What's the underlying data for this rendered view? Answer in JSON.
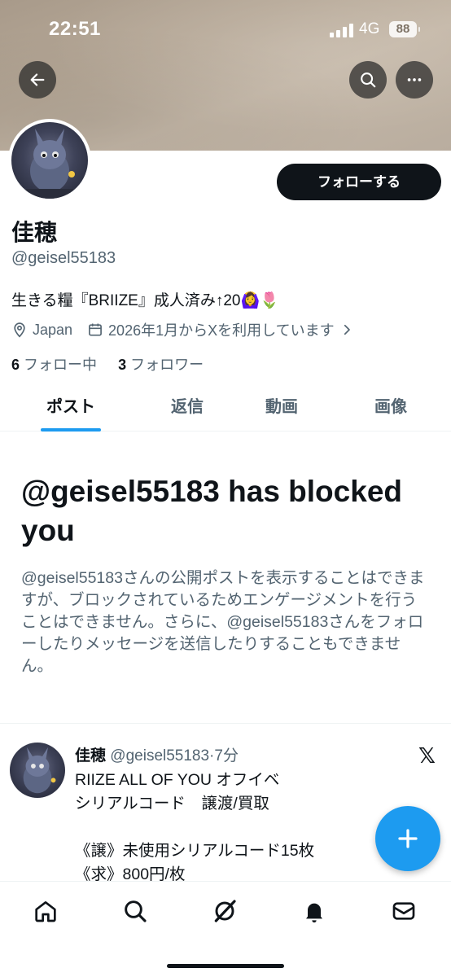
{
  "status_bar": {
    "time": "22:51",
    "network": "4G",
    "battery": "88"
  },
  "profile": {
    "name": "佳穂",
    "handle": "@geisel55183",
    "bio": "生きる糧『BRIIZE』成人済み↑20🙆‍♀️🌷",
    "location": "Japan",
    "joined": "2026年1月からXを利用しています",
    "following_count": "6",
    "following_label": "フォロー中",
    "followers_count": "3",
    "followers_label": "フォロワー",
    "follow_button": "フォローする"
  },
  "tabs": [
    "ポスト",
    "返信",
    "動画",
    "画像"
  ],
  "blocked": {
    "title": "@geisel55183 has blocked you",
    "description": "@geisel55183さんの公開ポストを表示することはできますが、ブロックされているためエンゲージメントを行うことはできません。さらに、@geisel55183さんをフォローしたりメッセージを送信したりすることもできません。"
  },
  "post": {
    "name": "佳穂",
    "meta": "@geisel55183·7分",
    "lines": [
      "RIIZE ALL OF YOU オフイベ",
      "シリアルコード　譲渡/買取",
      "",
      "《譲》未使用シリアルコード15枚",
      "《求》800円/枚"
    ]
  },
  "icons": {
    "back": "arrow-left-icon",
    "search": "search-icon",
    "more": "more-icon",
    "location": "location-pin-icon",
    "calendar": "calendar-icon",
    "home": "home-icon",
    "explore": "search-icon",
    "grok": "grok-icon",
    "notifications": "bell-icon",
    "messages": "mail-icon",
    "compose": "plus-icon"
  },
  "colors": {
    "accent": "#1d9bf0",
    "text": "#0f1419",
    "secondary": "#536471",
    "follow_button_bg": "#0f1419"
  }
}
